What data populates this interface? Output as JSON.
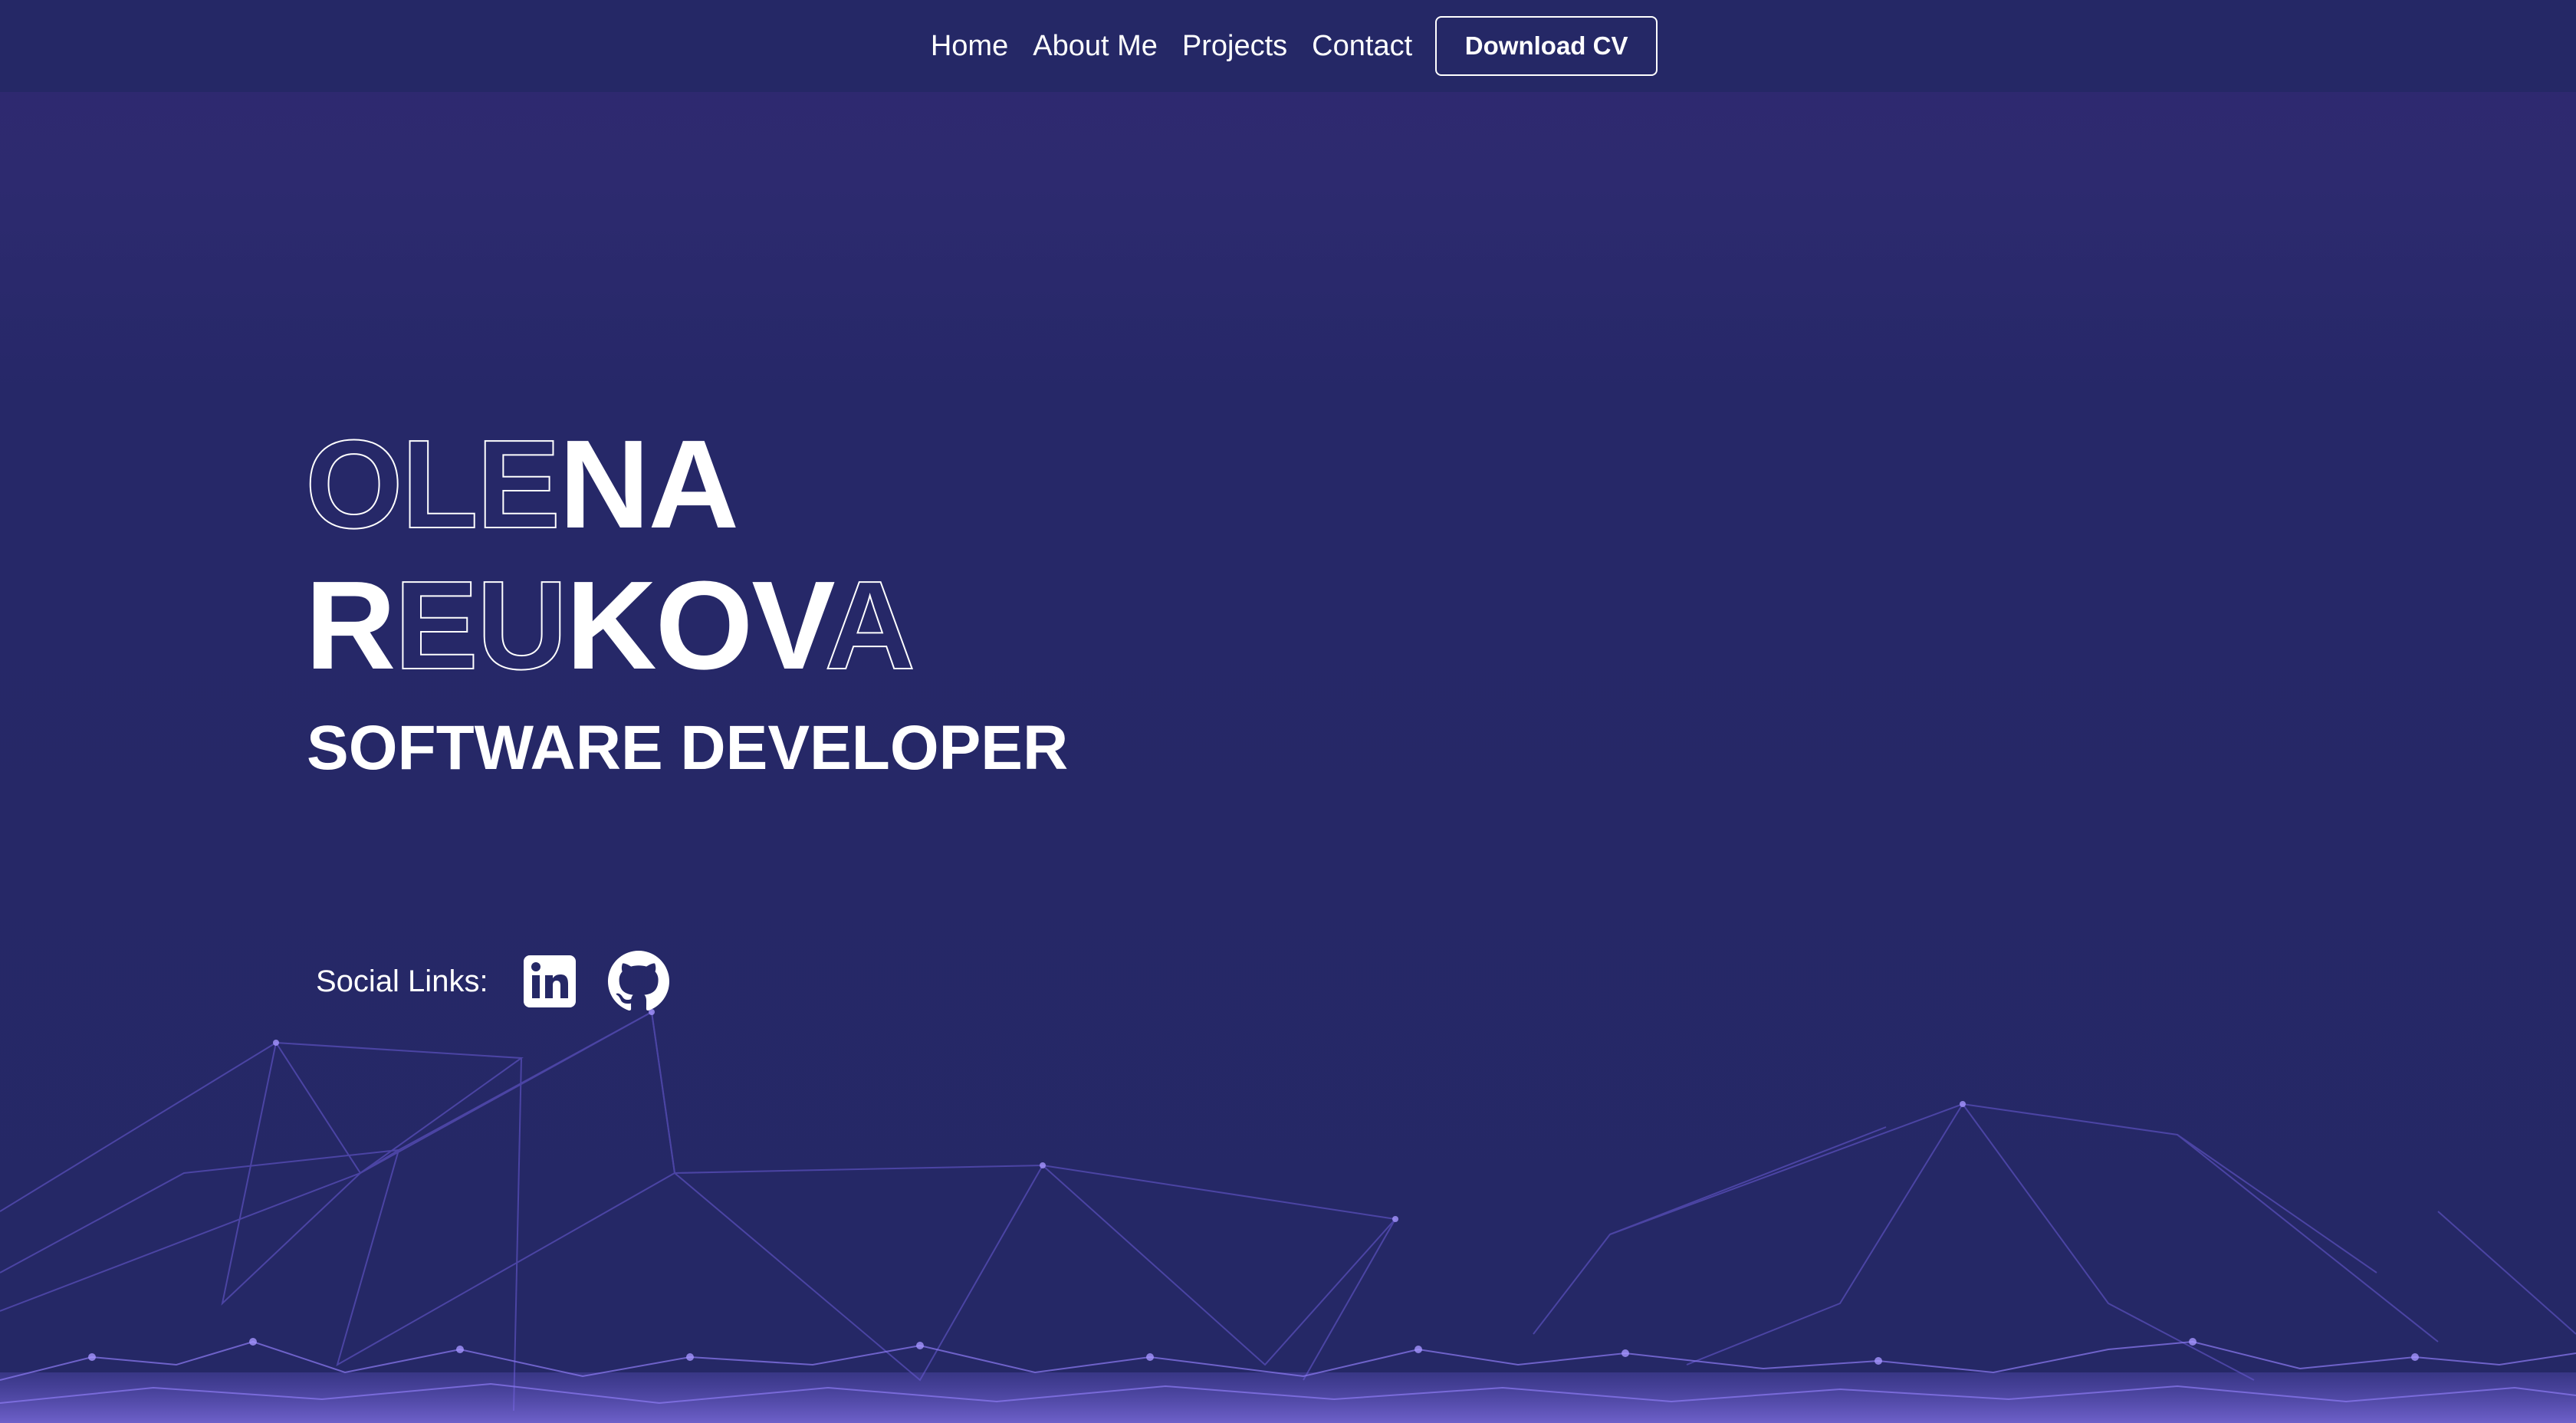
{
  "nav": {
    "links": [
      {
        "label": "Home"
      },
      {
        "label": "About Me"
      },
      {
        "label": "Projects"
      },
      {
        "label": "Contact"
      }
    ],
    "cv_button": "Download CV"
  },
  "hero": {
    "first_name": "OLENA",
    "last_name": "REUKOVA",
    "role": "SOFTWARE DEVELOPER"
  },
  "social": {
    "label": "Social Links:",
    "links": [
      {
        "icon": "linkedin-icon"
      },
      {
        "icon": "github-icon"
      }
    ]
  },
  "colors": {
    "background": "#252866",
    "accent_network": "#6a5bd6",
    "text": "#ffffff"
  }
}
